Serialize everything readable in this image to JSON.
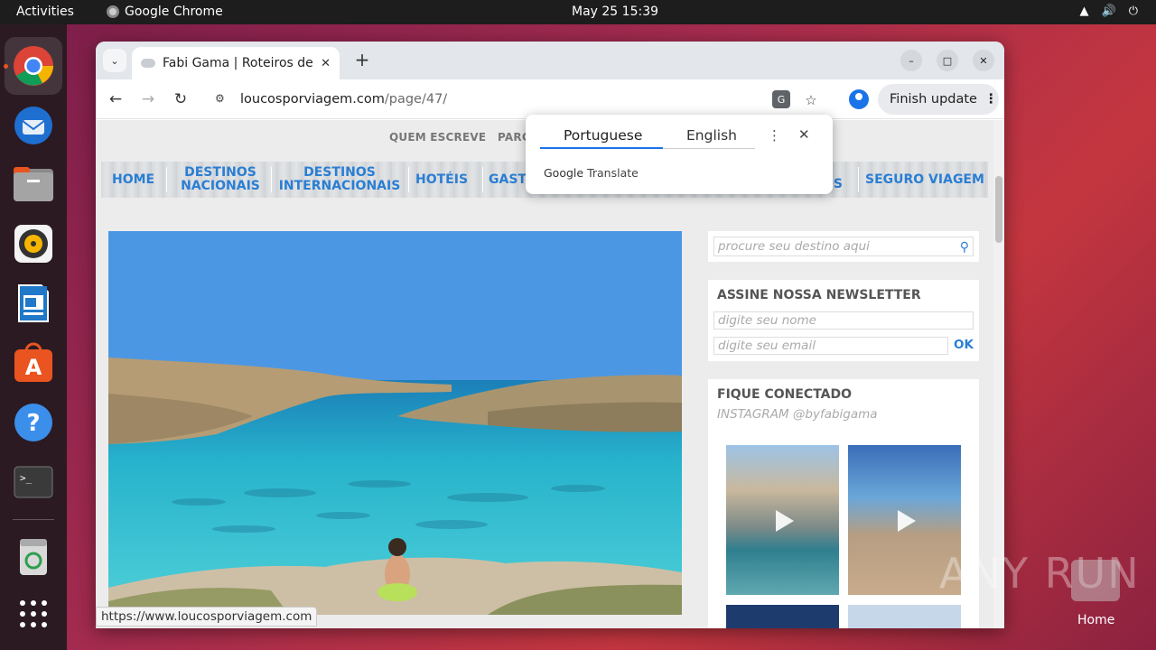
{
  "system": {
    "activities": "Activities",
    "app_name": "Google Chrome",
    "clock": "May 25  15:39"
  },
  "dock": {
    "items": [
      "chrome-icon",
      "thunderbird-icon",
      "files-icon",
      "rhythmbox-icon",
      "writer-icon",
      "app-center-icon",
      "help-icon",
      "terminal-icon",
      "trash-icon",
      "app-grid-icon"
    ]
  },
  "browser": {
    "tab_title": "Fabi Gama | Roteiros de V",
    "url_host": "loucosporviagem.com",
    "url_path": "/page/47/",
    "update_label": "Finish update",
    "status_url": "https://www.loucosporviagem.com"
  },
  "translate": {
    "source_lang": "Portuguese",
    "target_lang": "English",
    "brand": "Google",
    "product": "Translate"
  },
  "site": {
    "top_links": [
      "QUEM ESCREVE",
      "PARC"
    ],
    "menu": [
      {
        "l1": "HOME",
        "l2": ""
      },
      {
        "l1": "DESTINOS",
        "l2": "NACIONAIS"
      },
      {
        "l1": "DESTINOS",
        "l2": "INTERNACIONAIS"
      },
      {
        "l1": "HOTÉIS",
        "l2": ""
      },
      {
        "l1": "GAST",
        "l2": ""
      },
      {
        "l1": "OS",
        "l2": ""
      },
      {
        "l1": "SEGURO VIAGEM",
        "l2": ""
      }
    ],
    "search_placeholder": "procure seu destino aqui",
    "newsletter_title": "ASSINE NOSSA NEWSLETTER",
    "name_placeholder": "digite seu nome",
    "email_placeholder": "digite seu email",
    "ok_label": "OK",
    "connect_title": "FIQUE CONECTADO",
    "instagram_label": "INSTAGRAM @byfabigama"
  },
  "desktop": {
    "watermark": "ANY RUN",
    "home_label": "Home"
  }
}
